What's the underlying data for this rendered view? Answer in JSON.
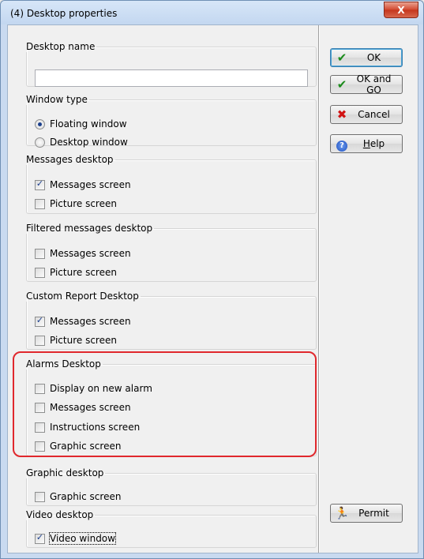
{
  "window": {
    "title": "(4) Desktop properties",
    "close_glyph": "X"
  },
  "desktop_name": {
    "legend": "Desktop name",
    "value": ""
  },
  "window_type": {
    "legend": "Window type",
    "options": [
      "Floating window",
      "Desktop window"
    ],
    "selected": "Floating window"
  },
  "messages_desktop": {
    "legend": "Messages desktop",
    "items": [
      {
        "label": "Messages screen",
        "checked": true
      },
      {
        "label": "Picture screen",
        "checked": false
      }
    ]
  },
  "filtered_messages_desktop": {
    "legend": "Filtered messages desktop",
    "items": [
      {
        "label": "Messages screen",
        "checked": false
      },
      {
        "label": "Picture screen",
        "checked": false
      }
    ]
  },
  "custom_report_desktop": {
    "legend": "Custom Report Desktop",
    "items": [
      {
        "label": "Messages screen",
        "checked": true
      },
      {
        "label": "Picture screen",
        "checked": false
      }
    ]
  },
  "alarms_desktop": {
    "legend": "Alarms Desktop",
    "items": [
      {
        "label": "Display on new alarm",
        "checked": false
      },
      {
        "label": "Messages screen",
        "checked": false
      },
      {
        "label": "Instructions screen",
        "checked": false
      },
      {
        "label": "Graphic screen",
        "checked": false
      }
    ]
  },
  "graphic_desktop": {
    "legend": "Graphic desktop",
    "items": [
      {
        "label": "Graphic screen",
        "checked": false
      }
    ]
  },
  "video_desktop": {
    "legend": "Video desktop",
    "items": [
      {
        "label": "Video window",
        "checked": true
      }
    ]
  },
  "buttons": {
    "ok": {
      "label": "OK",
      "icon": "checkmark-icon"
    },
    "ok_and_go": {
      "label": "OK and GO",
      "icon": "checkmark-icon"
    },
    "cancel": {
      "label": "Cancel",
      "icon": "red-x-icon"
    },
    "help": {
      "label_mnemonic": "H",
      "label_rest": "elp",
      "icon": "help-icon"
    },
    "permit": {
      "label": "Permit",
      "icon": "running-man-icon"
    }
  },
  "colors": {
    "highlight": "#e0282d",
    "ok_icon": "#1c8b1c",
    "cancel_icon": "#d11313"
  }
}
